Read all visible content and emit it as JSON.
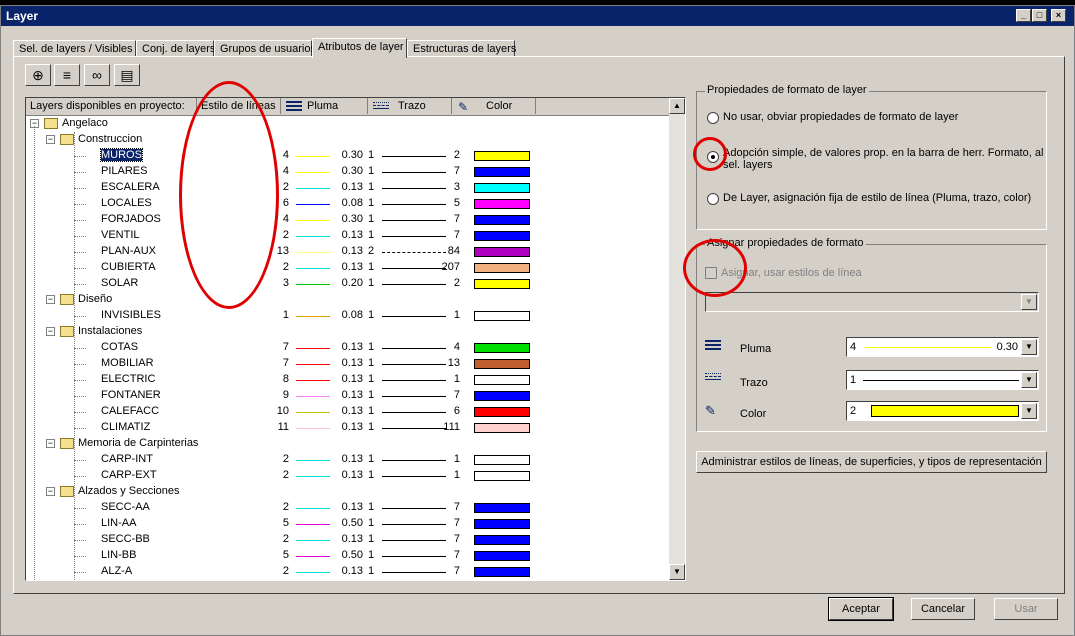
{
  "window": {
    "title": "Layer"
  },
  "tabs": [
    "Sel. de layers / Visibles",
    "Conj. de layers",
    "Grupos de usuarios",
    "Atributos de layer",
    "Estructuras de layers"
  ],
  "active_tab": 3,
  "columns": {
    "layers": "Layers disponibles en proyecto:",
    "style": "Estilo de líneas",
    "pen": "Pluma",
    "stroke": "Trazo",
    "color": "Color"
  },
  "colors": {
    "accent": "#0a246a",
    "annotation": "#e00000"
  },
  "tree": [
    {
      "type": "group",
      "level": 0,
      "label": "Angelaco"
    },
    {
      "type": "group",
      "level": 1,
      "label": "Construccion"
    },
    {
      "type": "layer",
      "label": "MUROS",
      "pen": "4",
      "penColor": "#ffff00",
      "w": "0.30",
      "s": "1",
      "dash": false,
      "c": "2",
      "sw": "#ffff00",
      "selected": true
    },
    {
      "type": "layer",
      "label": "PILARES",
      "pen": "4",
      "penColor": "#ffff00",
      "w": "0.30",
      "s": "1",
      "dash": false,
      "c": "7",
      "sw": "#0000ff"
    },
    {
      "type": "layer",
      "label": "ESCALERA",
      "pen": "2",
      "penColor": "#00e0e0",
      "w": "0.13",
      "s": "1",
      "dash": false,
      "c": "3",
      "sw": "#00ffff"
    },
    {
      "type": "layer",
      "label": "LOCALES",
      "pen": "6",
      "penColor": "#0000ff",
      "w": "0.08",
      "s": "1",
      "dash": false,
      "c": "5",
      "sw": "#ff00ff"
    },
    {
      "type": "layer",
      "label": "FORJADOS",
      "pen": "4",
      "penColor": "#ffff00",
      "w": "0.30",
      "s": "1",
      "dash": false,
      "c": "7",
      "sw": "#0000ff"
    },
    {
      "type": "layer",
      "label": "VENTIL",
      "pen": "2",
      "penColor": "#00e0e0",
      "w": "0.13",
      "s": "1",
      "dash": false,
      "c": "7",
      "sw": "#0000ff"
    },
    {
      "type": "layer",
      "label": "PLAN-AUX",
      "pen": "13",
      "penColor": "#ffff80",
      "w": "0.13",
      "s": "2",
      "dash": true,
      "c": "84",
      "sw": "#b000c0"
    },
    {
      "type": "layer",
      "label": "CUBIERTA",
      "pen": "2",
      "penColor": "#00e0e0",
      "w": "0.13",
      "s": "1",
      "dash": false,
      "c": "207",
      "sw": "#f0b080"
    },
    {
      "type": "layer",
      "label": "SOLAR",
      "pen": "3",
      "penColor": "#00c000",
      "w": "0.20",
      "s": "1",
      "dash": false,
      "c": "2",
      "sw": "#ffff00"
    },
    {
      "type": "group",
      "level": 1,
      "label": "Diseño"
    },
    {
      "type": "layer",
      "label": "INVISIBLES",
      "pen": "1",
      "penColor": "#e0a000",
      "w": "0.08",
      "s": "1",
      "dash": false,
      "c": "1",
      "sw": "#ffffff"
    },
    {
      "type": "group",
      "level": 1,
      "label": "Instalaciones"
    },
    {
      "type": "layer",
      "label": "COTAS",
      "pen": "7",
      "penColor": "#ff0000",
      "w": "0.13",
      "s": "1",
      "dash": false,
      "c": "4",
      "sw": "#00e000"
    },
    {
      "type": "layer",
      "label": "MOBILIAR",
      "pen": "7",
      "penColor": "#ff0000",
      "w": "0.13",
      "s": "1",
      "dash": false,
      "c": "13",
      "sw": "#c06030"
    },
    {
      "type": "layer",
      "label": "ELECTRIC",
      "pen": "8",
      "penColor": "#ff0000",
      "w": "0.13",
      "s": "1",
      "dash": false,
      "c": "1",
      "sw": "#ffffff"
    },
    {
      "type": "layer",
      "label": "FONTANER",
      "pen": "9",
      "penColor": "#ff80ff",
      "w": "0.13",
      "s": "1",
      "dash": false,
      "c": "7",
      "sw": "#0000ff"
    },
    {
      "type": "layer",
      "label": "CALEFACC",
      "pen": "10",
      "penColor": "#c0c000",
      "w": "0.13",
      "s": "1",
      "dash": false,
      "c": "6",
      "sw": "#ff0000"
    },
    {
      "type": "layer",
      "label": "CLIMATIZ",
      "pen": "11",
      "penColor": "#ffc0e0",
      "w": "0.13",
      "s": "1",
      "dash": false,
      "c": "111",
      "sw": "#ffd0d0"
    },
    {
      "type": "group",
      "level": 1,
      "label": "Memoria de Carpinterias"
    },
    {
      "type": "layer",
      "label": "CARP-INT",
      "pen": "2",
      "penColor": "#00e0e0",
      "w": "0.13",
      "s": "1",
      "dash": false,
      "c": "1",
      "sw": "#ffffff"
    },
    {
      "type": "layer",
      "label": "CARP-EXT",
      "pen": "2",
      "penColor": "#00e0e0",
      "w": "0.13",
      "s": "1",
      "dash": false,
      "c": "1",
      "sw": "#ffffff"
    },
    {
      "type": "group",
      "level": 1,
      "label": "Alzados y Secciones"
    },
    {
      "type": "layer",
      "label": "SECC-AA",
      "pen": "2",
      "penColor": "#00e0e0",
      "w": "0.13",
      "s": "1",
      "dash": false,
      "c": "7",
      "sw": "#0000ff"
    },
    {
      "type": "layer",
      "label": "LIN-AA",
      "pen": "5",
      "penColor": "#e000e0",
      "w": "0.50",
      "s": "1",
      "dash": false,
      "c": "7",
      "sw": "#0000ff"
    },
    {
      "type": "layer",
      "label": "SECC-BB",
      "pen": "2",
      "penColor": "#00e0e0",
      "w": "0.13",
      "s": "1",
      "dash": false,
      "c": "7",
      "sw": "#0000ff"
    },
    {
      "type": "layer",
      "label": "LIN-BB",
      "pen": "5",
      "penColor": "#e000e0",
      "w": "0.50",
      "s": "1",
      "dash": false,
      "c": "7",
      "sw": "#0000ff"
    },
    {
      "type": "layer",
      "label": "ALZ-A",
      "pen": "2",
      "penColor": "#00e0e0",
      "w": "0.13",
      "s": "1",
      "dash": false,
      "c": "7",
      "sw": "#0000ff"
    }
  ],
  "format_props": {
    "title": "Propiedades de formato de layer",
    "opt1": "No usar, obviar propiedades de formato de layer",
    "opt2_line1": "Adopción simple, de valores prop. en la barra de herr. Formato, al",
    "opt2_line2": "sel. layers",
    "opt3": "De Layer, asignación fija de estilo de línea (Pluma, trazo, color)",
    "selected": 2
  },
  "assign": {
    "title": "Asignar propiedades de formato",
    "checkbox": "Asignar, usar estilos de línea",
    "pen_label": "Pluma",
    "pen_value": "4",
    "pen_width": "0.30",
    "pen_color": "#ffff00",
    "stroke_label": "Trazo",
    "stroke_value": "1",
    "color_label": "Color",
    "color_value": "2",
    "color_swatch": "#ffff00"
  },
  "manage_button": "Administrar estilos de líneas, de superficies, y tipos de representación",
  "buttons": {
    "ok": "Aceptar",
    "cancel": "Cancelar",
    "apply": "Usar"
  }
}
